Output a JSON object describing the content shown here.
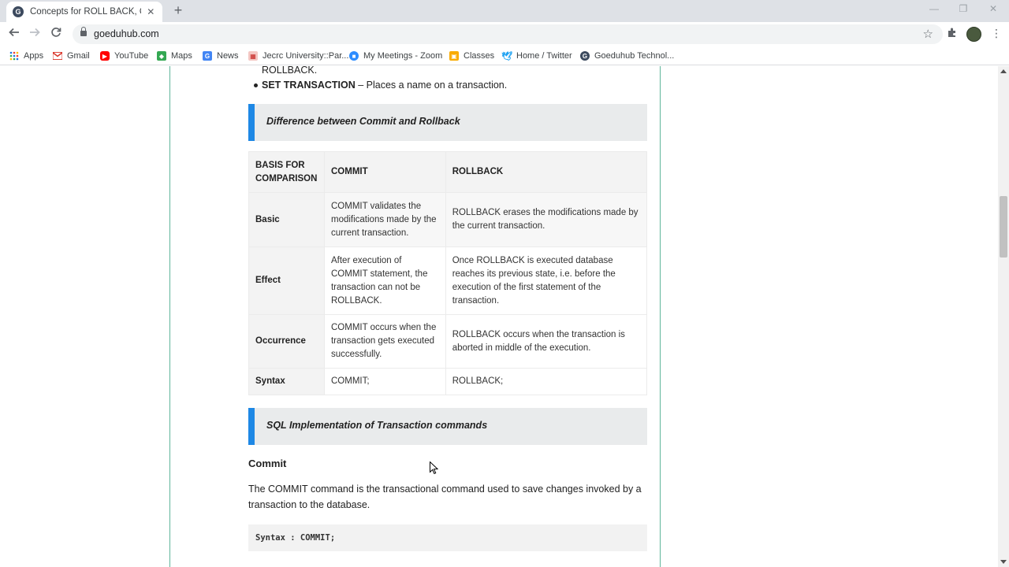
{
  "browser": {
    "tab_title": "Concepts for ROLL BACK, COMMIT",
    "tab_favicon_letter": "G",
    "url": "goeduhub.com",
    "bookmarks": [
      {
        "label": "Apps",
        "icon": "apps-grid-icon",
        "color": "#1a73e8"
      },
      {
        "label": "Gmail",
        "icon": "gmail-icon",
        "color": "#d93025"
      },
      {
        "label": "YouTube",
        "icon": "youtube-icon",
        "color": "#ff0000"
      },
      {
        "label": "Maps",
        "icon": "maps-icon",
        "color": "#34a853"
      },
      {
        "label": "News",
        "icon": "news-icon",
        "color": "#4285f4"
      },
      {
        "label": "Jecrc University::Par...",
        "icon": "jecrc-icon",
        "color": "#c5221f"
      },
      {
        "label": "My Meetings - Zoom",
        "icon": "zoom-icon",
        "color": "#2d8cff"
      },
      {
        "label": "Classes",
        "icon": "classroom-icon",
        "color": "#f9ab00"
      },
      {
        "label": "Home / Twitter",
        "icon": "twitter-icon",
        "color": "#1da1f2"
      },
      {
        "label": "Goeduhub Technol...",
        "icon": "goeduhub-icon",
        "color": "#3c4a5e"
      }
    ]
  },
  "page": {
    "bullet_prev_tail": "ROLLBACK.",
    "bullet_set_transaction_term": "SET TRANSACTION",
    "bullet_set_transaction_desc": " – Places a name on a transaction.",
    "callout_difference": "Difference between Commit and Rollback",
    "table": {
      "headers": [
        "BASIS FOR COMPARISON",
        "COMMIT",
        "ROLLBACK"
      ],
      "rows": [
        [
          "Basic",
          "COMMIT validates the modifications made by the current transaction.",
          "ROLLBACK erases the modifications made by the current transaction."
        ],
        [
          "Effect",
          "After execution of COMMIT statement, the transaction can not be ROLLBACK.",
          "Once ROLLBACK is executed database reaches its previous state, i.e. before the execution of the first statement of the transaction."
        ],
        [
          "Occurrence",
          "COMMIT occurs when the transaction gets executed successfully.",
          "ROLLBACK occurs when the transaction is aborted in middle of the execution."
        ],
        [
          "Syntax",
          "COMMIT;",
          "ROLLBACK;"
        ]
      ]
    },
    "callout_sql": "SQL Implementation of Transaction commands",
    "commit_heading": "Commit",
    "commit_paragraph": "The COMMIT command is the transactional command used to save changes invoked by a transaction to the database.",
    "commit_syntax": "Syntax : COMMIT;"
  },
  "colors": {
    "accent_blue": "#1e88e5",
    "content_border_green": "#5fb59a"
  }
}
